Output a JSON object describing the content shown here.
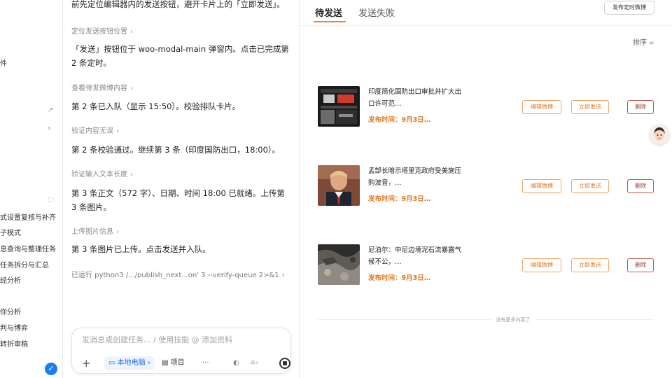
{
  "sidebar": {
    "items": [
      {
        "label": "件"
      },
      {
        "label": "式设置复核与补齐"
      },
      {
        "label": "子模式"
      },
      {
        "label": "息查询与整理任务"
      },
      {
        "label": "任务拆分与汇总"
      },
      {
        "label": "经分析"
      },
      {
        "label": "你分析"
      },
      {
        "label": "判与博弈"
      },
      {
        "label": "转折审稿"
      }
    ]
  },
  "chat": {
    "top_text": "前先定位编辑器内的发送按钮，避开卡片上的「立即发送」。",
    "steps": [
      {
        "link": "定位发送按钮位置",
        "text": "「发送」按钮位于 woo-modal-main 弹窗内。点击已完成第 2 条定时。"
      },
      {
        "link": "查看待发微博内容",
        "text": "第 2 条已入队（显示 15:50）。校验排队卡片。"
      },
      {
        "link": "验证内容无误",
        "text": "第 2 条校验通过。继续第 3 条（印度国防出口，18:00）。"
      },
      {
        "link": "验证输入文本长度",
        "text": "第 3 条正文（572 字）、日期、时间 18:00 已就绪。上传第 3 条图片。"
      },
      {
        "link": "上传图片信息",
        "text": "第 3 条图片已上传。点击发送并入队。"
      }
    ],
    "command": "已运行 python3 /.../publish_next...on' 3 --verify-queue 2>&1",
    "composer": {
      "placeholder": "发消息或创建任务... / 使用技能 @ 添加资料",
      "local_label": "本地电脑",
      "project_label": "项目",
      "more_label": "···"
    }
  },
  "right": {
    "tabs": [
      {
        "label": "待发送",
        "active": true
      },
      {
        "label": "发送失败",
        "active": false
      }
    ],
    "schedule_button": "发布定时微博",
    "sort_label": "排序",
    "posts": [
      {
        "title": "印度简化国防出口审批并扩大出口许可范…",
        "time": "发布时间：9月3日…",
        "edit": "编辑微博",
        "send": "立即发送",
        "delete": "删除"
      },
      {
        "title": "孟郜长暗示塔里克政府受美施压购波音，…",
        "time": "发布时间：9月3日…",
        "edit": "编辑微博",
        "send": "立即发送",
        "delete": "删除"
      },
      {
        "title": "尼泊尔：中尼边境泥石流暴露气候不公，…",
        "time": "发布时间：9月3日…",
        "edit": "编辑微博",
        "send": "立即发送",
        "delete": "删除"
      }
    ],
    "no_more": "没有更多内容了",
    "accent_color": "#e07b26"
  }
}
